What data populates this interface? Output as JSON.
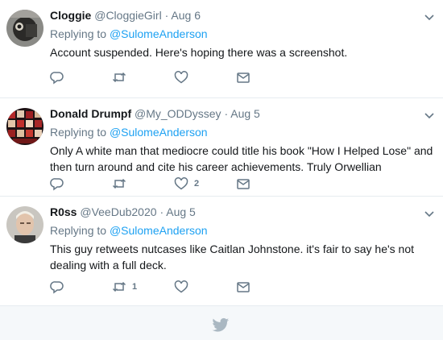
{
  "tweets": [
    {
      "name": "Cloggie",
      "handle": "@CloggieGirl",
      "dot": "·",
      "date": "Aug 6",
      "reply_prefix": "Replying to ",
      "reply_to": "@SulomeAnderson",
      "text": "Account suspended. Here's hoping there was a screenshot.",
      "likes": "",
      "retweets": ""
    },
    {
      "name": "Donald Drumpf",
      "handle": "@My_ODDyssey",
      "dot": "·",
      "date": "Aug 5",
      "reply_prefix": "Replying to ",
      "reply_to": "@SulomeAnderson",
      "text": "Only A white man that mediocre could title his book \"How I Helped Lose\" and then turn around and cite his career achievements. Truly Orwellian",
      "likes": "2",
      "retweets": ""
    },
    {
      "name": "R0ss",
      "handle": "@VeeDub2020",
      "dot": "·",
      "date": "Aug 5",
      "reply_prefix": "Replying to ",
      "reply_to": "@SulomeAnderson",
      "text": "This guy retweets nutcases like Caitlan Johnstone. it's fair to say he's not dealing with a full deck.",
      "likes": "",
      "retweets": "1"
    }
  ],
  "icons": {
    "reply": "reply-icon",
    "retweet": "retweet-icon",
    "like": "heart-icon",
    "dm": "envelope-icon",
    "menu": "chevron-down-icon",
    "footer": "twitter-bird-icon"
  },
  "colors": {
    "link": "#1da1f2",
    "muted": "#657786",
    "border": "#e6ecf0",
    "footer_bg": "#f5f8fa"
  }
}
